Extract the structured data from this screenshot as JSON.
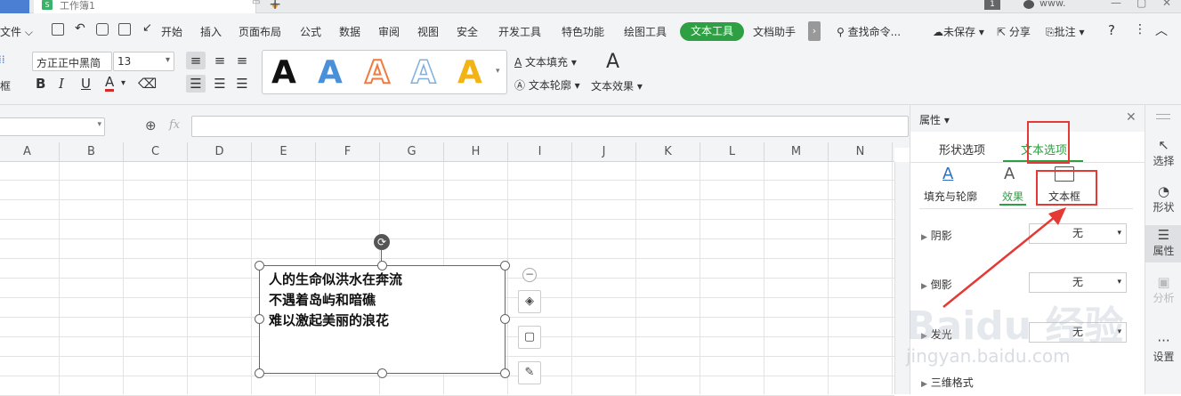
{
  "tabbar": {
    "doc_title": "工作簿1",
    "doc_icon": "S",
    "new_tab": "+",
    "user_badge": "1",
    "user_name": "www."
  },
  "menubar": {
    "file": "文件",
    "items": [
      "开始",
      "插入",
      "页面布局",
      "公式",
      "数据",
      "审阅",
      "视图",
      "安全",
      "开发工具",
      "特色功能",
      "绘图工具"
    ],
    "active": "文本工具",
    "doc_helper": "文档助手",
    "search": "查找命令...",
    "unsaved": "未保存",
    "share": "分享",
    "annotate": "批注",
    "help": "?"
  },
  "ribbon": {
    "font_name": "方正正中黑简",
    "font_size": "13",
    "text_fill": "文本填充",
    "text_outline": "文本轮廓",
    "text_effect": "文本效果",
    "left_label": "框",
    "wordart_colors": [
      "#111111",
      "#4a90d9",
      "#f07b3f",
      "#7fb0e0",
      "#f2b315"
    ]
  },
  "formula_bar": {
    "fx": "fx"
  },
  "columns": [
    "A",
    "B",
    "C",
    "D",
    "E",
    "F",
    "G",
    "H",
    "I",
    "J",
    "K",
    "L",
    "M",
    "N"
  ],
  "textbox": {
    "lines": [
      "人的生命似洪水在奔流",
      "不遇着岛屿和暗礁",
      "难以激起美丽的浪花"
    ]
  },
  "panel": {
    "title": "属性",
    "tabs": [
      "形状选项",
      "文本选项"
    ],
    "subtabs": [
      "填充与轮廓",
      "效果",
      "文本框"
    ],
    "rows": [
      {
        "label": "阴影",
        "value": "无"
      },
      {
        "label": "倒影",
        "value": "无"
      },
      {
        "label": "发光",
        "value": "无"
      },
      {
        "label": "三维格式",
        "value": ""
      }
    ]
  },
  "rail": [
    "选择",
    "形状",
    "属性",
    "分析",
    "设置"
  ],
  "watermark": {
    "main": "Baidu 经验",
    "sub": "jingyan.baidu.com"
  },
  "colors": {
    "accent": "#2ea043",
    "annotation": "#e53935"
  }
}
